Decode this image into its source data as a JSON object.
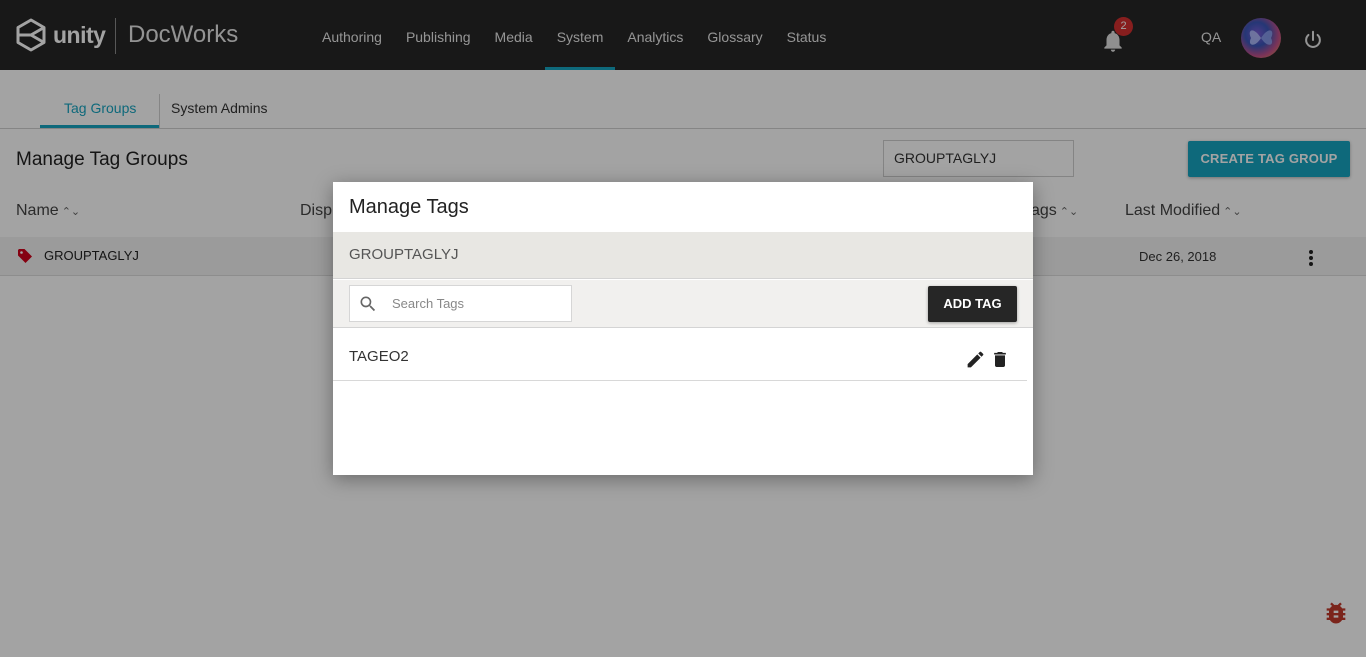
{
  "header": {
    "logo_text": "unity",
    "app_name": "DocWorks",
    "nav": [
      {
        "label": "Authoring"
      },
      {
        "label": "Publishing"
      },
      {
        "label": "Media"
      },
      {
        "label": "System",
        "active": true
      },
      {
        "label": "Analytics"
      },
      {
        "label": "Glossary"
      },
      {
        "label": "Status"
      }
    ],
    "notification_count": "2",
    "user_initials": "QA",
    "icons": [
      "unity-logo-icon",
      "bell-icon",
      "avatar",
      "power-icon"
    ]
  },
  "tabs": [
    {
      "label": "Tag Groups",
      "active": true
    },
    {
      "label": "System Admins"
    }
  ],
  "page": {
    "title": "Manage Tag Groups",
    "filter_value": "GROUPTAGLYJ",
    "create_button": "CREATE TAG GROUP",
    "columns": {
      "name": "Name",
      "display": "Disp",
      "tags": "ags",
      "last_modified": "Last Modified"
    },
    "rows": [
      {
        "name": "GROUPTAGLYJ",
        "last_modified": "Dec 26, 2018"
      }
    ]
  },
  "modal": {
    "title": "Manage Tags",
    "group_name": "GROUPTAGLYJ",
    "search_placeholder": "Search Tags",
    "add_button": "ADD TAG",
    "tags": [
      {
        "name": "TAGEO2"
      }
    ]
  },
  "colors": {
    "accent": "#17a4c0",
    "topbar": "#262626",
    "badge": "#d32f2f",
    "tag_icon": "#d0021b",
    "bug_icon": "#c0392b"
  }
}
